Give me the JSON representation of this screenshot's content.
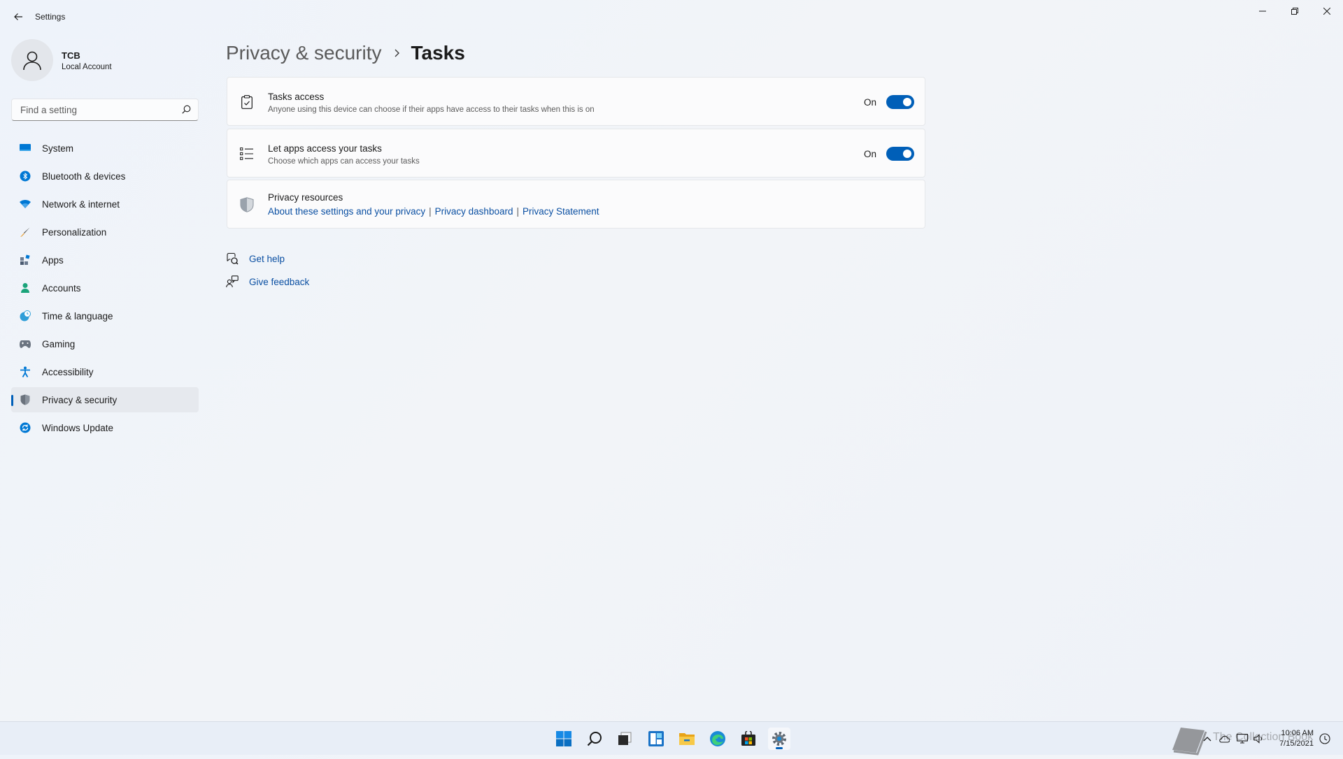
{
  "window": {
    "title": "Settings"
  },
  "profile": {
    "name": "TCB",
    "account_type": "Local Account"
  },
  "search": {
    "placeholder": "Find a setting",
    "value": ""
  },
  "sidebar": {
    "items": [
      {
        "label": "System",
        "icon": "monitor-icon",
        "selected": false
      },
      {
        "label": "Bluetooth & devices",
        "icon": "bluetooth-icon",
        "selected": false
      },
      {
        "label": "Network & internet",
        "icon": "wifi-icon",
        "selected": false
      },
      {
        "label": "Personalization",
        "icon": "brush-icon",
        "selected": false
      },
      {
        "label": "Apps",
        "icon": "apps-icon",
        "selected": false
      },
      {
        "label": "Accounts",
        "icon": "person-icon",
        "selected": false
      },
      {
        "label": "Time & language",
        "icon": "globe-clock-icon",
        "selected": false
      },
      {
        "label": "Gaming",
        "icon": "gamepad-icon",
        "selected": false
      },
      {
        "label": "Accessibility",
        "icon": "accessibility-icon",
        "selected": false
      },
      {
        "label": "Privacy & security",
        "icon": "shield-icon",
        "selected": true
      },
      {
        "label": "Windows Update",
        "icon": "update-icon",
        "selected": false
      }
    ]
  },
  "breadcrumb": {
    "parent": "Privacy & security",
    "current": "Tasks"
  },
  "cards": {
    "tasks_access": {
      "title": "Tasks access",
      "description": "Anyone using this device can choose if their apps have access to their tasks when this is on",
      "state_label": "On",
      "on": true,
      "icon": "clipboard-check-icon"
    },
    "apps_access": {
      "title": "Let apps access your tasks",
      "description": "Choose which apps can access your tasks",
      "state_label": "On",
      "on": true,
      "icon": "task-list-icon"
    },
    "privacy_resources": {
      "title": "Privacy resources",
      "icon": "shield-icon",
      "links": [
        "About these settings and your privacy",
        "Privacy dashboard",
        "Privacy Statement"
      ],
      "separator": "|"
    }
  },
  "help": {
    "get_help": "Get help",
    "give_feedback": "Give feedback"
  },
  "taskbar": {
    "apps": [
      "start-icon",
      "search-icon",
      "task-view-icon",
      "widgets-icon",
      "file-explorer-icon",
      "edge-icon",
      "store-icon",
      "settings-icon"
    ],
    "active_app": "settings-icon",
    "clock_time": "10:06 AM",
    "clock_date": "7/15/2021",
    "watermark_text": "The Collection Book"
  },
  "colors": {
    "accent": "#005fb8",
    "link": "#0a4fa2"
  }
}
